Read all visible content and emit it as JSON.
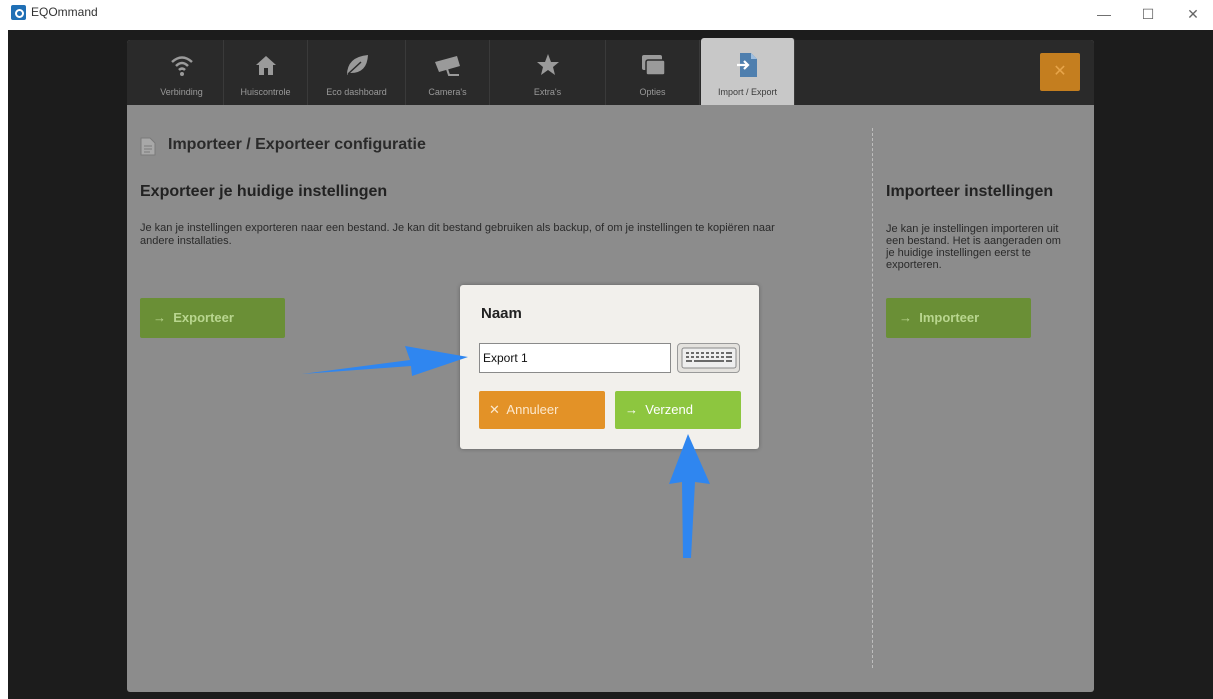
{
  "window": {
    "title": "EQOmmand",
    "minimize": "—",
    "maximize": "☐",
    "close": "✕"
  },
  "tabs": [
    {
      "label": "Verbinding",
      "icon": "wifi-icon"
    },
    {
      "label": "Huiscontrole",
      "icon": "home-icon"
    },
    {
      "label": "Eco dashboard",
      "icon": "leaf-icon"
    },
    {
      "label": "Camera's",
      "icon": "camera-icon"
    },
    {
      "label": "Extra's",
      "icon": "star-icon"
    },
    {
      "label": "Opties",
      "icon": "windows-icon"
    },
    {
      "label": "Import / Export",
      "icon": "import-export-icon",
      "active": true
    }
  ],
  "close_button": "✕",
  "page": {
    "title": "Importeer / Exporteer configuratie",
    "export": {
      "heading": "Exporteer je huidige instellingen",
      "line1": "Je kan je instellingen exporteren naar een bestand. Je kan dit bestand gebruiken als backup, of om je instellingen te kopiëren naar",
      "line2": "andere installaties.",
      "button": "Exporteer"
    },
    "import": {
      "heading": "Importeer instellingen",
      "lines": [
        "Je kan je instellingen importeren uit",
        "een bestand. Het is aangeraden om",
        "je huidige instellingen eerst te",
        "exporteren."
      ],
      "button": "Importeer"
    }
  },
  "dialog": {
    "title": "Naam",
    "input_value": "Export 1",
    "cancel_label": "Annuleer",
    "send_label": "Verzend"
  },
  "colors": {
    "accent_orange": "#e39227",
    "accent_green": "#8dc63f",
    "dark_green": "#6a8f36"
  }
}
